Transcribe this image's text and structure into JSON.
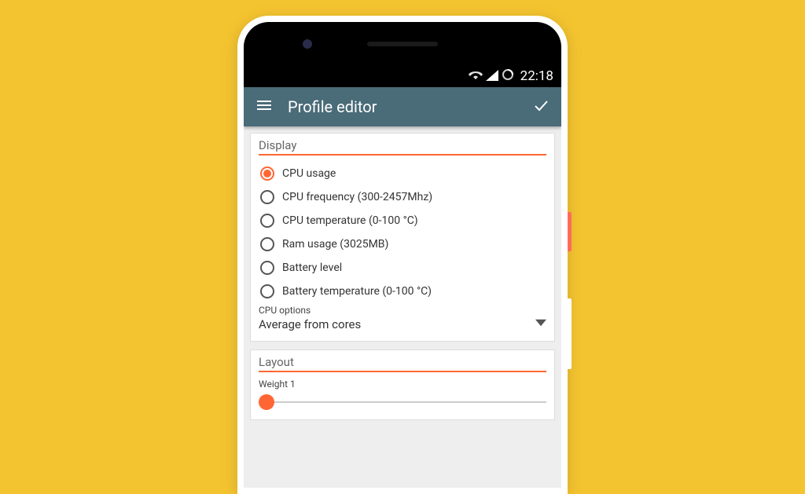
{
  "statusBar": {
    "time": "22:18"
  },
  "appBar": {
    "title": "Profile editor"
  },
  "display": {
    "sectionTitle": "Display",
    "options": [
      "CPU usage",
      "CPU frequency (300-2457Mhz)",
      "CPU temperature (0-100 °C)",
      "Ram usage (3025MB)",
      "Battery level",
      "Battery temperature (0-100 °C)"
    ],
    "selectedIndex": 0,
    "cpuOptionsLabel": "CPU options",
    "cpuOptionsValue": "Average from cores"
  },
  "layout": {
    "sectionTitle": "Layout",
    "weightLabel": "Weight  1"
  }
}
